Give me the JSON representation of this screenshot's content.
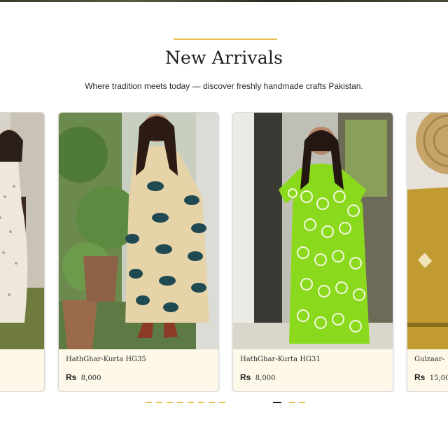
{
  "section": {
    "title": "New Arrivals",
    "subtitle": "Where tradition meets today — discover freshly handmade crafts Pakistan."
  },
  "products": [
    {
      "name": "",
      "currency": "",
      "amount": ""
    },
    {
      "name": "HathGhar-Kurta HG35",
      "currency": "Rs",
      "amount": "8,000"
    },
    {
      "name": "HathGhar-Kurta HG31",
      "currency": "Rs",
      "amount": "8,000"
    },
    {
      "name": "Gulzaar-",
      "currency": "Rs",
      "amount": "15,00"
    }
  ],
  "carousel": {
    "dot_count": 10,
    "active_index": 8
  },
  "colors": {
    "accent": "#e7c24d",
    "card_bg": "#fdf8e9",
    "text": "#1e1e1e"
  }
}
